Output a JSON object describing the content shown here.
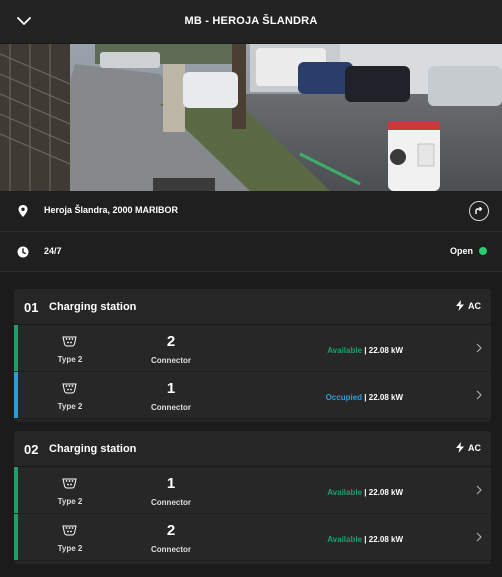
{
  "header": {
    "title": "MB - HEROJA ŠLANDRA"
  },
  "location": {
    "address": "Heroja Šlandra, 2000 MARIBOR"
  },
  "hours": {
    "schedule": "24/7",
    "open_label": "Open"
  },
  "colors": {
    "available": "#1f9e6b",
    "occupied": "#2a9fd6",
    "open": "#2ecc71"
  },
  "stations": [
    {
      "number": "01",
      "title": "Charging station",
      "current": "AC",
      "connectors": [
        {
          "plug": "Type 2",
          "number": "2",
          "label": "Connector",
          "status": "Available",
          "separator": "|",
          "power": "22.08 kW",
          "status_kind": "available"
        },
        {
          "plug": "Type 2",
          "number": "1",
          "label": "Connector",
          "status": "Occupied",
          "separator": "|",
          "power": "22.08 kW",
          "status_kind": "occupied"
        }
      ]
    },
    {
      "number": "02",
      "title": "Charging station",
      "current": "AC",
      "connectors": [
        {
          "plug": "Type 2",
          "number": "1",
          "label": "Connector",
          "status": "Available",
          "separator": "|",
          "power": "22.08 kW",
          "status_kind": "available"
        },
        {
          "plug": "Type 2",
          "number": "2",
          "label": "Connector",
          "status": "Available",
          "separator": "|",
          "power": "22.08 kW",
          "status_kind": "available"
        }
      ]
    }
  ]
}
